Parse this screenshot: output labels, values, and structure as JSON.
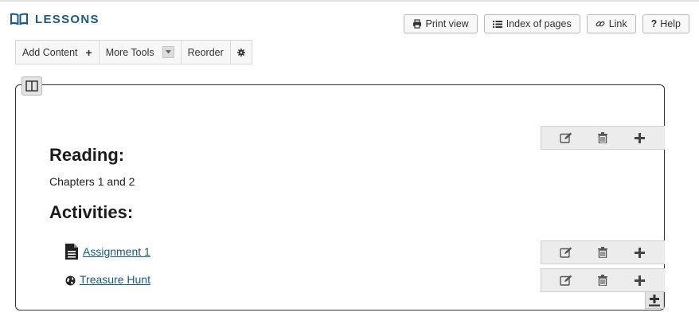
{
  "header": {
    "title": "LESSONS",
    "title_icon": "book-icon"
  },
  "top_buttons": [
    {
      "label": "Print view",
      "icon": "print-icon"
    },
    {
      "label": "Index of pages",
      "icon": "list-icon"
    },
    {
      "label": "Link",
      "icon": "link-icon"
    },
    {
      "label": "Help",
      "icon": "question-icon"
    }
  ],
  "toolbar": {
    "add_content": "Add Content",
    "more_tools": "More Tools",
    "reorder": "Reorder"
  },
  "content": {
    "reading_heading": "Reading:",
    "reading_text": "Chapters 1 and 2",
    "activities_heading": "Activities:",
    "items": [
      {
        "label": "Assignment 1",
        "icon": "document-icon"
      },
      {
        "label": "Treasure Hunt",
        "icon": "globe-icon"
      }
    ]
  },
  "colors": {
    "title": "#1e5a7a",
    "link": "#1d5a73",
    "toolbar_bg": "#f7f7f7",
    "action_bg": "#ececec"
  }
}
